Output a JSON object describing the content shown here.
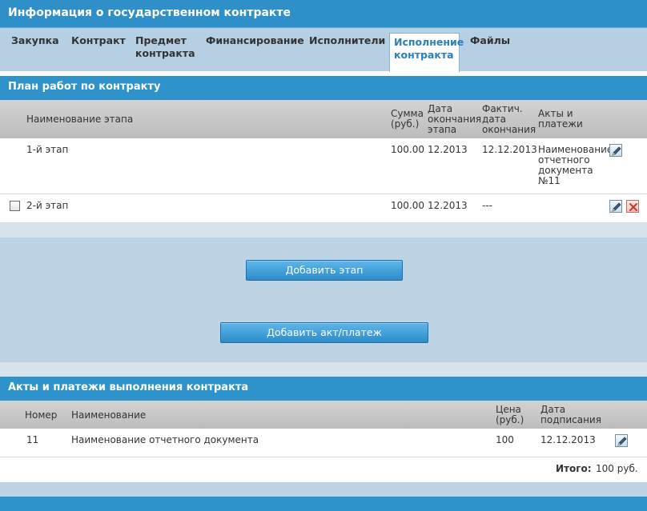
{
  "header": {
    "title": "Информация о государственном контракте"
  },
  "tabs": [
    {
      "label": "Закупка"
    },
    {
      "label": "Контракт"
    },
    {
      "label": "Предмет\nконтракта"
    },
    {
      "label": "Финансирование"
    },
    {
      "label": "Исполнители"
    },
    {
      "label": "Исполнение\nконтракта"
    },
    {
      "label": "Файлы"
    }
  ],
  "plan": {
    "title": "План работ по контракту",
    "columns": {
      "name": "Наименование этапа",
      "sum": "Сумма\n(руб.)",
      "end_date": "Дата\nокончания\nэтапа",
      "actual_date": "Фактич.\nдата\nокончания",
      "acts": "Акты и\nплатежи"
    },
    "rows": [
      {
        "name": "1-й этап",
        "sum": "100.00",
        "end_date": "12.2013",
        "actual_date": "12.12.2013",
        "acts": "Наименование\nотчетного\nдокумента\n№11"
      },
      {
        "name": "2-й этап",
        "sum": "100.00",
        "end_date": "12.2013",
        "actual_date": "---",
        "acts": ""
      }
    ],
    "add_stage_label": "Добавить этап",
    "add_act_label": "Добавить акт/платеж"
  },
  "acts": {
    "title": "Акты и платежи выполнения контракта",
    "columns": {
      "number": "Номер",
      "name": "Наименование",
      "price": "Цена\n(руб.)",
      "sign_date": "Дата\nподписания"
    },
    "rows": [
      {
        "number": "11",
        "name": "Наименование отчетного документа",
        "price": "100",
        "sign_date": "12.12.2013"
      }
    ],
    "total_label": "Итого:",
    "total_value": "100 руб."
  },
  "icons": {
    "edit": "edit-pencil-icon",
    "delete": "delete-x-icon"
  },
  "colors": {
    "header_blue": "#2f8fc8",
    "panel_blue": "#bdd4e6",
    "button_blue": "#3d9fd8",
    "delete_red": "#c0392b"
  }
}
